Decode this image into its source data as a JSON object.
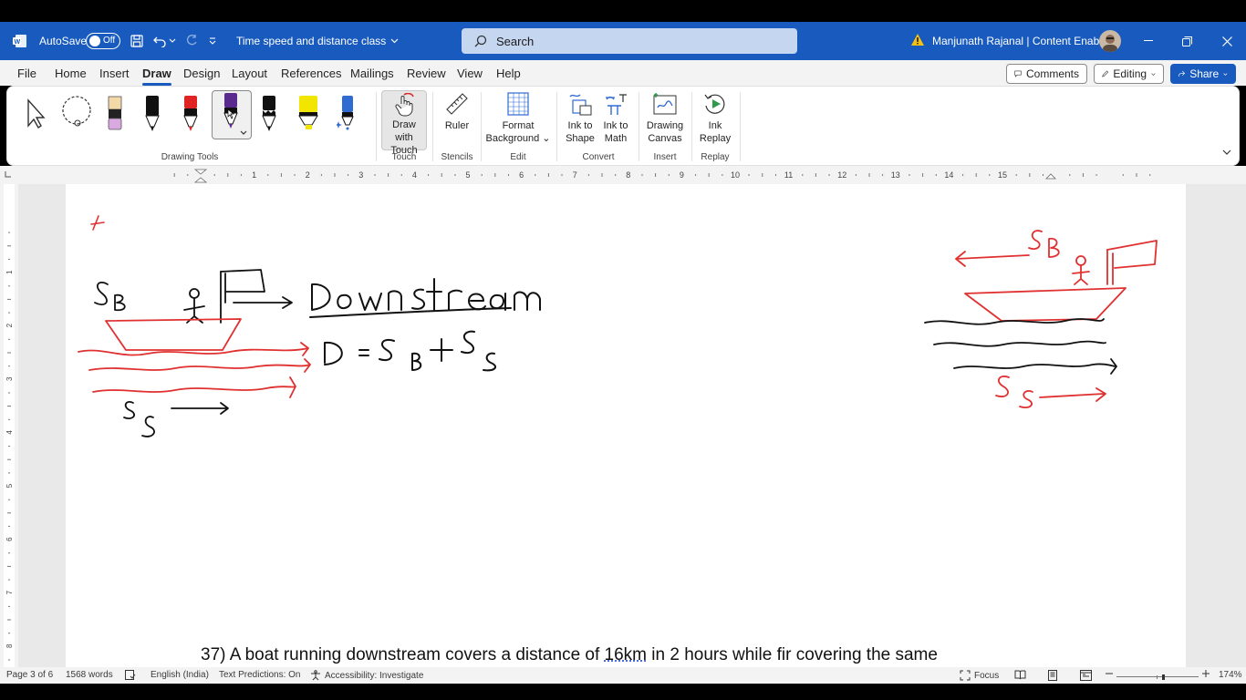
{
  "titlebar": {
    "autosave_label": "AutoSave",
    "autosave_state": "Off",
    "doc_title": "Time speed and distance class",
    "search_placeholder": "Search",
    "user_name": "Manjunath Rajanal | Content Enablers",
    "brand_color": "#185abd"
  },
  "menu": {
    "items": [
      "File",
      "Home",
      "Insert",
      "Draw",
      "Design",
      "Layout",
      "References",
      "Mailings",
      "Review",
      "View",
      "Help"
    ],
    "active": "Draw",
    "comments_label": "Comments",
    "editing_label": "Editing",
    "share_label": "Share"
  },
  "ribbon": {
    "tools": [
      "select-arrow",
      "lasso",
      "eraser",
      "pen-black",
      "pen-red",
      "pen-purple",
      "pencil-black",
      "highlighter-yellow",
      "galaxy-pen"
    ],
    "groups": {
      "drawing_tools": "Drawing Tools",
      "touch": "Touch",
      "stencils": "Stencils",
      "edit": "Edit",
      "convert": "Convert",
      "insert": "Insert",
      "replay": "Replay"
    },
    "buttons": {
      "draw_with_touch": [
        "Draw with",
        "Touch"
      ],
      "ruler": "Ruler",
      "format_background": [
        "Format",
        "Background"
      ],
      "ink_to_shape": [
        "Ink to",
        "Shape"
      ],
      "ink_to_math": [
        "Ink to",
        "Math"
      ],
      "drawing_canvas": [
        "Drawing",
        "Canvas"
      ],
      "ink_replay": [
        "Ink",
        "Replay"
      ]
    }
  },
  "ruler": {
    "numbers": [
      "1",
      "2",
      "3",
      "4",
      "5",
      "6",
      "7",
      "8",
      "9",
      "10",
      "11",
      "12",
      "13",
      "14",
      "15"
    ],
    "vertical_numbers": [
      "1",
      "2",
      "3",
      "4",
      "5",
      "6",
      "7",
      "8"
    ]
  },
  "document": {
    "question_prefix": "37) A boat running downstream covers a distance of ",
    "question_underlined": "16km",
    "question_suffix": " in 2 hours while fir covering the same"
  },
  "statusbar": {
    "page": "Page 3 of 6",
    "words": "1568 words",
    "language": "English (India)",
    "text_predictions": "Text Predictions: On",
    "accessibility": "Accessibility: Investigate",
    "focus": "Focus",
    "zoom": "174%"
  }
}
